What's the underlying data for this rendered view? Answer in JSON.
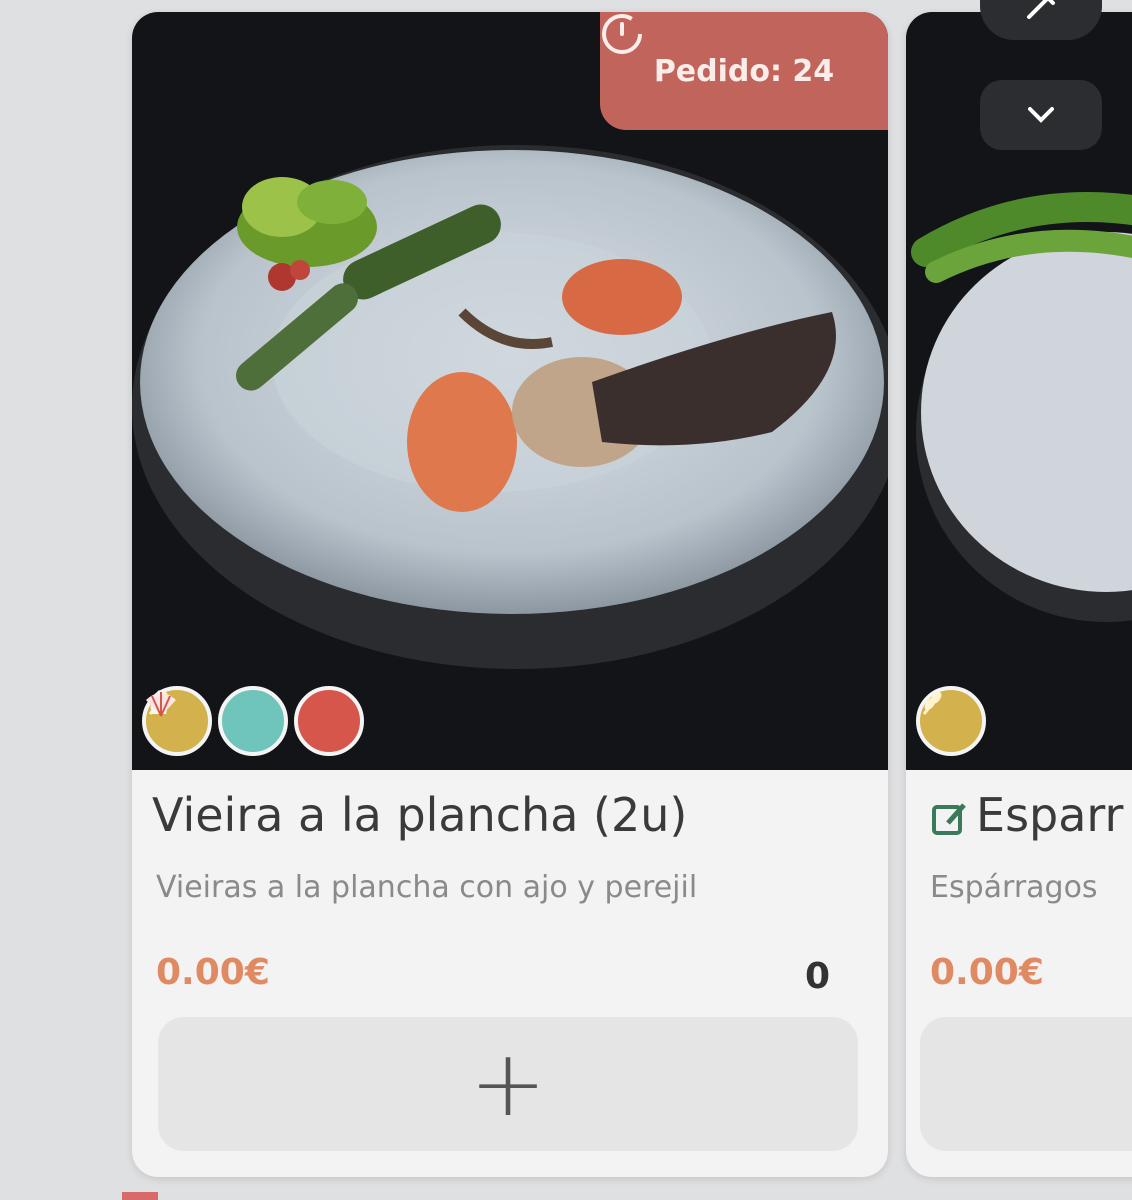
{
  "products": [
    {
      "order_badge": "Pedido: 24",
      "title": "Vieira a la plancha (2u)",
      "description": "Vieiras a la plancha con ajo y perejil",
      "price": "0.00€",
      "quantity": "0",
      "add_label": "+",
      "allergens": [
        "gluten-icon",
        "mollusc-icon",
        "shellfish-icon"
      ]
    },
    {
      "title": "Esparr",
      "description": "Espárragos",
      "price": "0.00€",
      "add_label": "",
      "allergens": [
        "gluten-icon"
      ]
    }
  ],
  "controls": {
    "top_icons": [
      "edit-icon",
      "chevron-down-icon"
    ]
  },
  "colors": {
    "badge": "#c0645c",
    "price": "#e08a64",
    "gluten": "#d3b24e",
    "mollusc": "#6fc4bb",
    "shellfish": "#d6564c"
  }
}
